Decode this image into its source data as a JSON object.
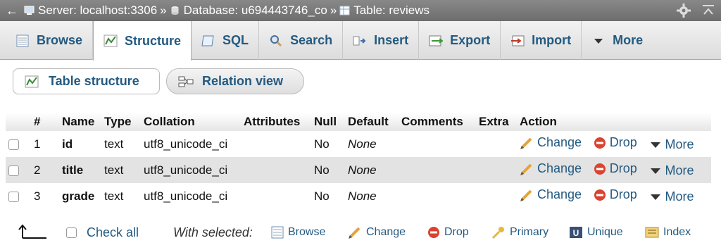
{
  "breadcrumb": {
    "back_glyph": "←",
    "server": "Server: localhost:3306",
    "database": "Database: u694443746_co",
    "table": "Table: reviews",
    "separator": "»"
  },
  "tabs": [
    {
      "label": "Browse",
      "icon": "browse-icon"
    },
    {
      "label": "Structure",
      "icon": "structure-icon"
    },
    {
      "label": "SQL",
      "icon": "sql-icon"
    },
    {
      "label": "Search",
      "icon": "search-icon"
    },
    {
      "label": "Insert",
      "icon": "insert-icon"
    },
    {
      "label": "Export",
      "icon": "export-icon"
    },
    {
      "label": "Import",
      "icon": "import-icon"
    },
    {
      "label": "More",
      "icon": "chevron-down-icon"
    }
  ],
  "subtabs": {
    "table_structure": "Table structure",
    "relation_view": "Relation view"
  },
  "columns_header": [
    "#",
    "Name",
    "Type",
    "Collation",
    "Attributes",
    "Null",
    "Default",
    "Comments",
    "Extra",
    "Action"
  ],
  "rows": [
    {
      "num": "1",
      "name": "id",
      "type": "text",
      "collation": "utf8_unicode_ci",
      "null": "No",
      "default": "None"
    },
    {
      "num": "2",
      "name": "title",
      "type": "text",
      "collation": "utf8_unicode_ci",
      "null": "No",
      "default": "None"
    },
    {
      "num": "3",
      "name": "grade",
      "type": "text",
      "collation": "utf8_unicode_ci",
      "null": "No",
      "default": "None"
    }
  ],
  "row_actions": {
    "change": "Change",
    "drop": "Drop",
    "more": "More"
  },
  "footer": {
    "check_all": "Check all",
    "with_selected": "With selected:",
    "browse": "Browse",
    "change": "Change",
    "drop": "Drop",
    "primary": "Primary",
    "unique": "Unique",
    "index": "Index"
  },
  "colors": {
    "link": "#235a81",
    "drop_red": "#d9432f",
    "pencil": "#e6a23c"
  }
}
